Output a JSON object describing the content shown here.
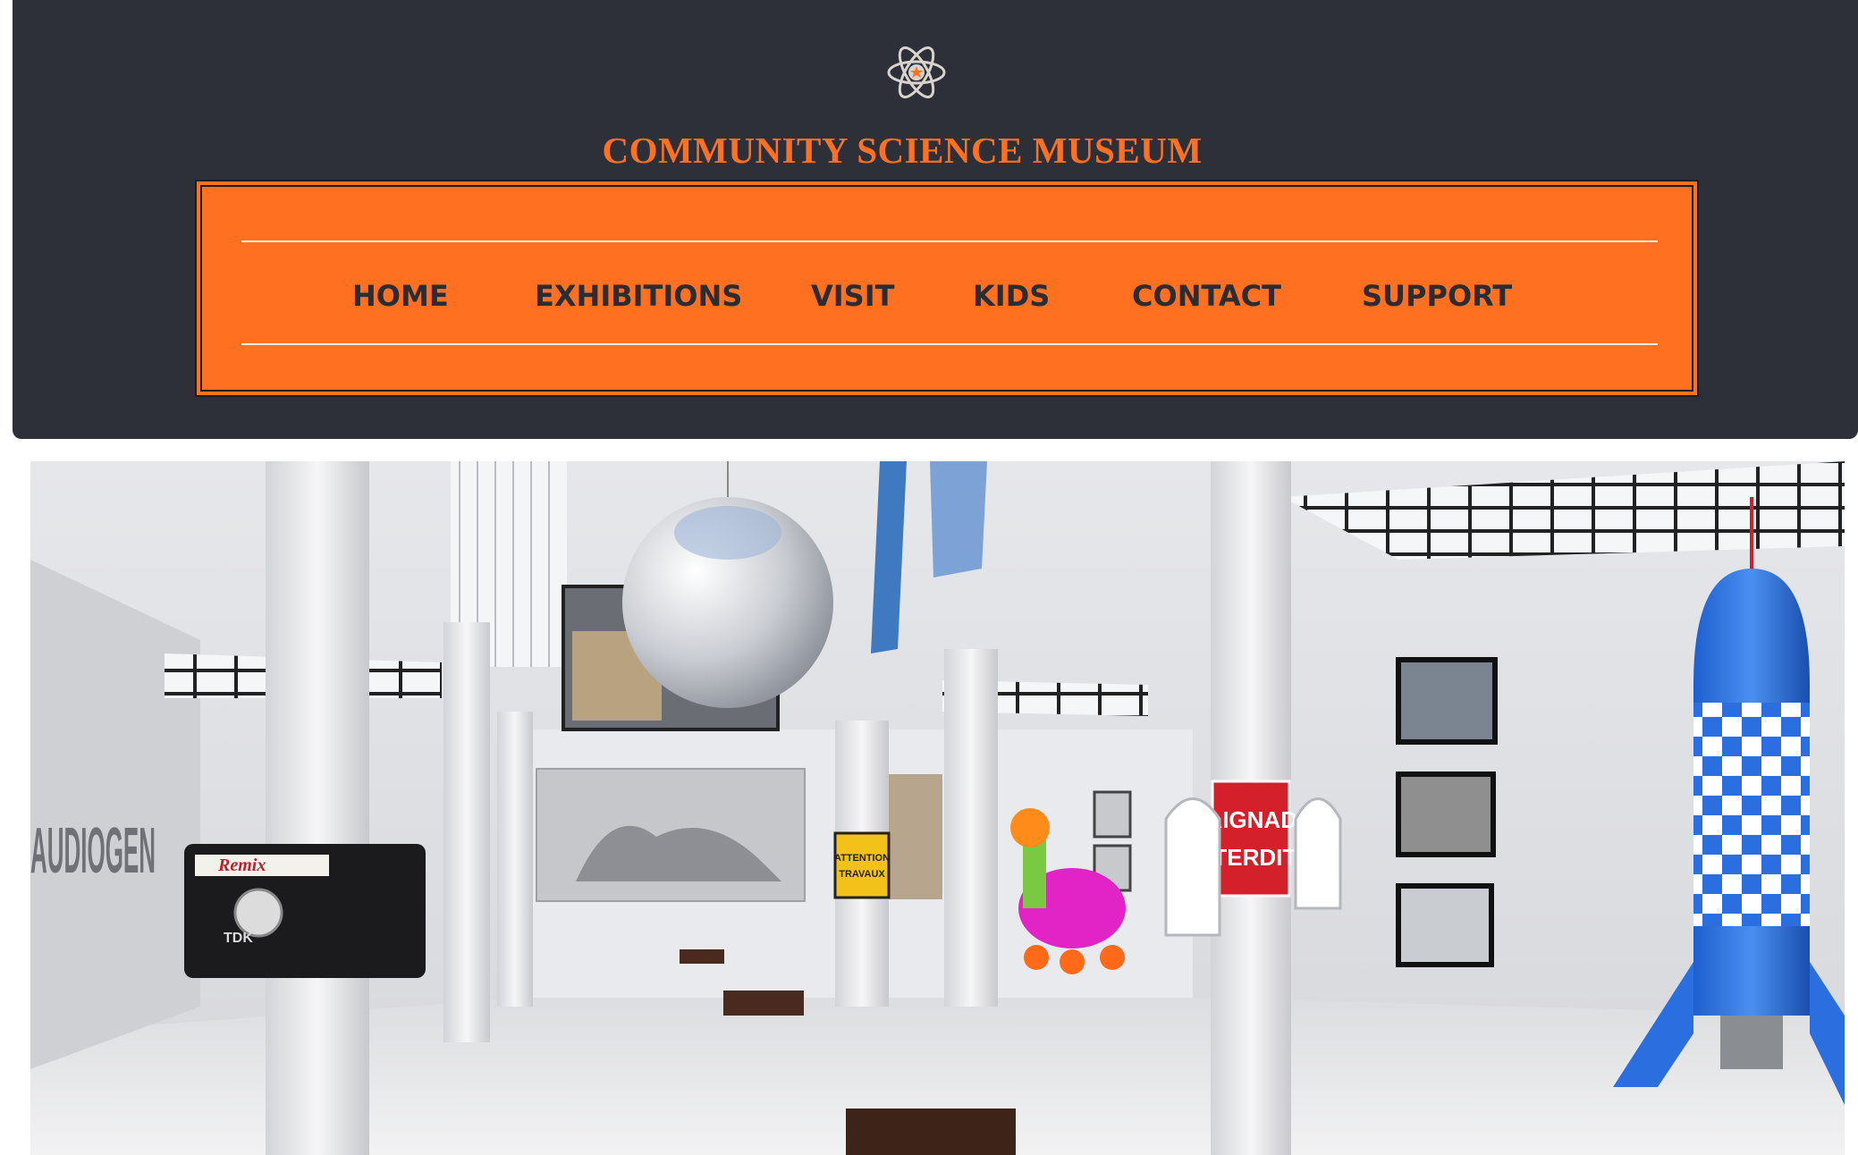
{
  "header": {
    "logo_icon": "atom-icon",
    "site_title": "COMMUNITY SCIENCE MUSEUM",
    "accent_color": "#ff7120",
    "background_color": "#2d3038"
  },
  "nav": {
    "items": [
      {
        "label": "HOME"
      },
      {
        "label": "EXHIBITIONS"
      },
      {
        "label": "VISIT"
      },
      {
        "label": "KIDS"
      },
      {
        "label": "CONTACT"
      },
      {
        "label": "SUPPORT"
      }
    ]
  },
  "hero": {
    "image_subject": "museum-gallery-interior",
    "pillar_sign_line1": "BAIGNADE",
    "pillar_sign_line2": "INTERDITE",
    "tape_label": "Remix",
    "tape_brand": "TDK",
    "wall_letters": "AUDIOGEN",
    "caution_line1": "ATTENTION",
    "caution_line2": "TRAVAUX"
  }
}
